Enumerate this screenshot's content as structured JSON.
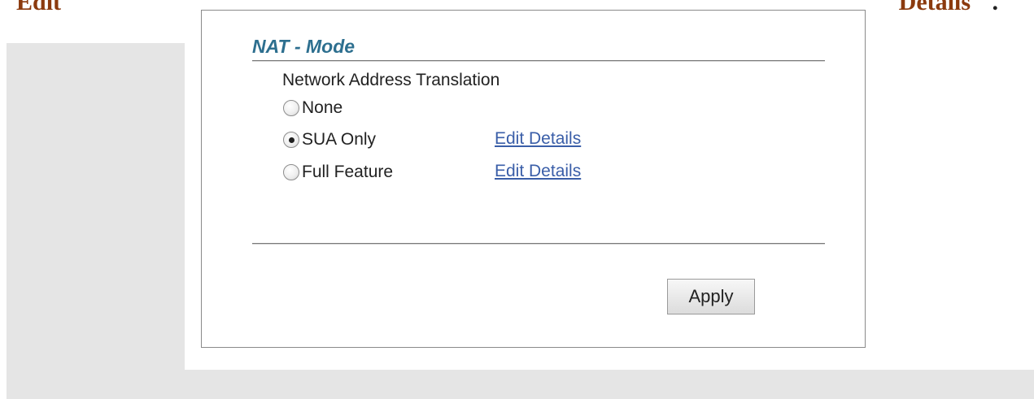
{
  "header": {
    "left_text": "Edit",
    "right_text": "Details",
    "right_punct": "."
  },
  "panel": {
    "title": "NAT - Mode",
    "section_label": "Network Address Translation",
    "options": [
      {
        "label": "None",
        "checked": false
      },
      {
        "label": "SUA Only",
        "checked": true,
        "link": "Edit Details"
      },
      {
        "label": "Full Feature",
        "checked": false,
        "link": "Edit Details"
      }
    ],
    "apply_label": "Apply"
  }
}
